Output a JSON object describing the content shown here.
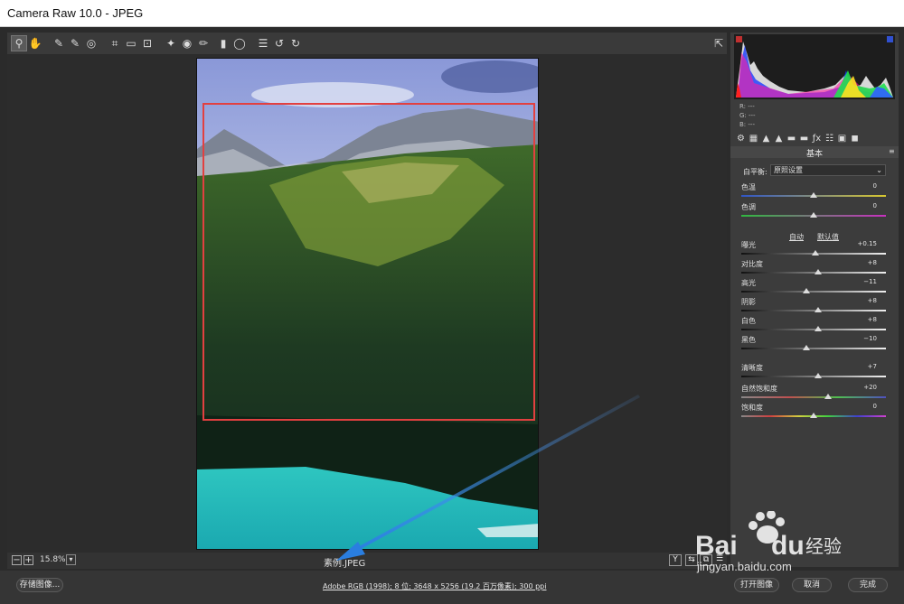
{
  "window": {
    "title": "Camera Raw 10.0  -  JPEG"
  },
  "toolbar": {
    "tools": [
      {
        "name": "zoom-tool-icon",
        "glyph": "⚲",
        "active": true
      },
      {
        "name": "hand-tool-icon",
        "glyph": "✋"
      },
      {
        "name": "white-balance-tool-icon",
        "glyph": "✎"
      },
      {
        "name": "color-sampler-tool-icon",
        "glyph": "✎"
      },
      {
        "name": "targeted-adjust-tool-icon",
        "glyph": "◎"
      },
      {
        "name": "crop-tool-icon",
        "glyph": "⌗"
      },
      {
        "name": "straighten-tool-icon",
        "glyph": "▭"
      },
      {
        "name": "transform-tool-icon",
        "glyph": "⊡"
      },
      {
        "name": "spot-removal-tool-icon",
        "glyph": "✦"
      },
      {
        "name": "red-eye-tool-icon",
        "glyph": "◉"
      },
      {
        "name": "adjustment-brush-icon",
        "glyph": "✏"
      },
      {
        "name": "graduated-filter-icon",
        "glyph": "▮"
      },
      {
        "name": "radial-filter-icon",
        "glyph": "◯"
      },
      {
        "name": "preferences-icon",
        "glyph": "☰"
      },
      {
        "name": "rotate-left-icon",
        "glyph": "↺"
      },
      {
        "name": "rotate-right-icon",
        "glyph": "↻"
      }
    ],
    "fullscreen_glyph": "⇱"
  },
  "status": {
    "zoom_minus": "−",
    "zoom_plus": "+",
    "zoom_level": "15.8%",
    "zoom_caret": "▾",
    "filename": "素例.JPEG",
    "view_y": "Y"
  },
  "footer": {
    "save_label": "存储图像...",
    "info": "Adobe RGB (1998); 8 位; 3648 x 5256 (19.2 百万像素); 300 ppi",
    "open_label": "打开图像",
    "cancel_label": "取消",
    "done_label": "完成"
  },
  "panel": {
    "rgb": [
      "R:  ---",
      "G:  ---",
      "B:  ---"
    ],
    "tab_icons": [
      "⚙",
      "▦",
      "▲",
      "▲",
      "▬",
      "▬",
      "ƒx",
      "☷",
      "▣",
      "◼"
    ],
    "title": "基本",
    "menu_glyph": "≡",
    "wb_label": "白平衡:",
    "wb_value": "原照设置",
    "auto_label": "自动",
    "default_label": "默认值",
    "sliders": [
      {
        "label": "色温",
        "value": "0",
        "pos": 0.5,
        "gradient": "linear-gradient(90deg,#3056c8,#d8c830)"
      },
      {
        "label": "色调",
        "value": "0",
        "pos": 0.5,
        "gradient": "linear-gradient(90deg,#30b840,#c830c0)"
      },
      {
        "label": "曝光",
        "value": "+0.15",
        "pos": 0.51,
        "gradient": "linear-gradient(90deg,#111,#eee)"
      },
      {
        "label": "对比度",
        "value": "+8",
        "pos": 0.53,
        "gradient": "linear-gradient(90deg,#111,#eee)"
      },
      {
        "label": "高光",
        "value": "−11",
        "pos": 0.45,
        "gradient": "linear-gradient(90deg,#111,#eee)"
      },
      {
        "label": "阴影",
        "value": "+8",
        "pos": 0.53,
        "gradient": "linear-gradient(90deg,#111,#eee)"
      },
      {
        "label": "白色",
        "value": "+8",
        "pos": 0.53,
        "gradient": "linear-gradient(90deg,#111,#eee)"
      },
      {
        "label": "黑色",
        "value": "−10",
        "pos": 0.45,
        "gradient": "linear-gradient(90deg,#111,#eee)"
      },
      {
        "label": "清晰度",
        "value": "+7",
        "pos": 0.53,
        "gradient": "linear-gradient(90deg,#111,#eee)"
      },
      {
        "label": "自然饱和度",
        "value": "+20",
        "pos": 0.6,
        "gradient": "linear-gradient(90deg,#888,#c05050,#50c050,#5050c0)"
      },
      {
        "label": "饱和度",
        "value": "0",
        "pos": 0.5,
        "gradient": "linear-gradient(90deg,#888,#d04040,#d0d040,#40d040,#4040d0,#d040d0)"
      }
    ]
  },
  "watermark": {
    "brand": "Bai du 经验",
    "site": "jingyan.baidu.com"
  }
}
